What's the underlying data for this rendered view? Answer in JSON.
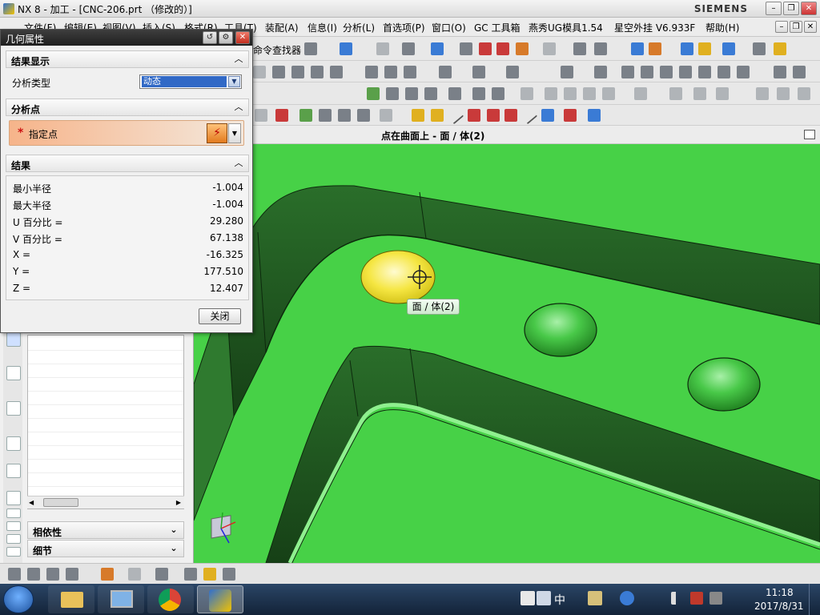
{
  "window": {
    "title": "NX 8 - 加工 - [CNC-206.prt （修改的）]",
    "brand": "SIEMENS",
    "min": "–",
    "restore": "❐",
    "close": "✕"
  },
  "menu": {
    "items": [
      "文件(F)",
      "编辑(E)",
      "视图(V)",
      "插入(S)",
      "格式(R)",
      "工具(T)",
      "装配(A)",
      "信息(I)",
      "分析(L)",
      "首选项(P)",
      "窗口(O)",
      "GC 工具箱",
      "燕秀UG模具1.54",
      "星空外挂 V6.933F",
      "帮助(H)"
    ],
    "command_finder": "命令查找器"
  },
  "viewport": {
    "title": "点在曲面上 - 面 / 体(2)",
    "tooltip": "面 / 体(2)"
  },
  "dialog": {
    "title": "几何属性",
    "sections": {
      "display": "结果显示",
      "analysis_point": "分析点",
      "results": "结果"
    },
    "analysis_type_label": "分析类型",
    "analysis_type_value": "动态",
    "specify_point_label": "指定点",
    "results": [
      {
        "k": "最小半径",
        "v": "-1.004"
      },
      {
        "k": "最大半径",
        "v": "-1.004"
      },
      {
        "k": "U 百分比 =",
        "v": "29.280"
      },
      {
        "k": "V 百分比 =",
        "v": "67.138"
      },
      {
        "k": "X =",
        "v": "-16.325"
      },
      {
        "k": "Y =",
        "v": "177.510"
      },
      {
        "k": "Z =",
        "v": "12.407"
      }
    ],
    "close_label": "关闭"
  },
  "navigator": {
    "dependency": "相依性",
    "details": "细节"
  },
  "taskbar": {
    "ime": "中",
    "time": "11:18",
    "date": "2017/8/31"
  },
  "colors": {
    "model_green": "#47d147",
    "wall_dark": "#1f5a1f",
    "highlight_yellow": "#f5e642"
  }
}
